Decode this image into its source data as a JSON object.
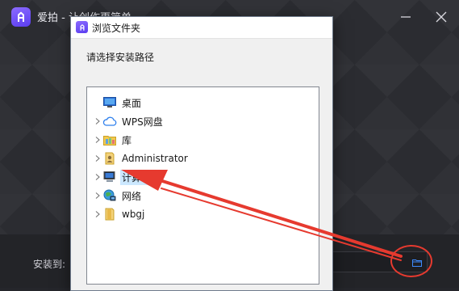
{
  "installer": {
    "title": "爱拍 - 让创作更简单",
    "install_label": "安装到:",
    "path_value": ""
  },
  "dialog": {
    "title": "浏览文件夹",
    "prompt": "请选择安装路径",
    "tree": [
      {
        "label": "桌面",
        "icon": "desktop-icon",
        "expandable": false
      },
      {
        "label": "WPS网盘",
        "icon": "cloud-icon",
        "expandable": true
      },
      {
        "label": "库",
        "icon": "library-icon",
        "expandable": true
      },
      {
        "label": "Administrator",
        "icon": "user-folder-icon",
        "expandable": true
      },
      {
        "label": "计算机",
        "icon": "computer-icon",
        "expandable": true
      },
      {
        "label": "网络",
        "icon": "network-icon",
        "expandable": true
      },
      {
        "label": "wbgj",
        "icon": "folder-icon",
        "expandable": true
      }
    ]
  },
  "colors": {
    "annotation_red": "#e63a2f",
    "brand_purple": "#6b4cf5",
    "selection_blue": "#cce8ff"
  }
}
